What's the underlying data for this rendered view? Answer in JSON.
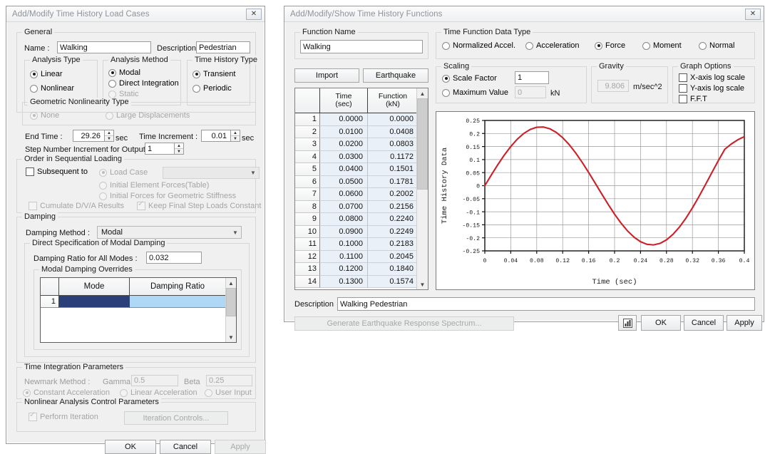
{
  "left_dialog": {
    "title": "Add/Modify Time History Load Cases",
    "close_icon": "close-icon",
    "general": {
      "legend": "General",
      "name_label": "Name :",
      "name_value": "Walking",
      "description_label": "Description :",
      "description_value": "Pedestrian",
      "analysis_type": {
        "legend": "Analysis Type",
        "options": [
          "Linear",
          "Nonlinear"
        ],
        "selected": "Linear"
      },
      "analysis_method": {
        "legend": "Analysis Method",
        "options": [
          "Modal",
          "Direct Integration",
          "Static"
        ],
        "selected": "Modal",
        "disabled": [
          "Static"
        ]
      },
      "time_history_type": {
        "legend": "Time History Type",
        "options": [
          "Transient",
          "Periodic"
        ],
        "selected": "Transient"
      },
      "geometric_nonlinearity": {
        "legend": "Geometric Nonlinearity Type",
        "options": [
          "None",
          "Large Displacements"
        ],
        "selected": "None",
        "disabled": true
      },
      "end_time_label": "End Time :",
      "end_time_value": "29.26",
      "end_time_unit": "sec",
      "time_increment_label": "Time Increment :",
      "time_increment_value": "0.01",
      "time_increment_unit": "sec",
      "step_number_label": "Step Number Increment for Output :",
      "step_number_value": "1"
    },
    "order_sequential": {
      "legend": "Order in Sequential Loading",
      "subsequent_to": "Subsequent to",
      "subsequent_checked": false,
      "radio_options": [
        "Load Case",
        "Initial Element Forces(Table)",
        "Initial Forces for Geometric Stiffness"
      ],
      "radio_selected": "Load Case",
      "combo_value": "",
      "cumulate_label": "Cumulate D/V/A Results",
      "cumulate_checked": false,
      "keep_final_label": "Keep Final Step Loads Constant",
      "keep_final_checked": true
    },
    "damping": {
      "legend": "Damping",
      "method_label": "Damping Method :",
      "method_value": "Modal",
      "direct_spec_legend": "Direct Specification of Modal Damping",
      "ratio_label": "Damping Ratio for All Modes :",
      "ratio_value": "0.032",
      "overrides_legend": "Modal Damping Overrides",
      "table_headers": [
        "",
        "Mode",
        "Damping Ratio"
      ],
      "table_rows": [
        {
          "index": "1",
          "mode": "",
          "ratio": ""
        }
      ]
    },
    "time_integration": {
      "legend": "Time Integration Parameters",
      "newmark_label": "Newmark Method :",
      "gamma_label": "Gamma",
      "gamma_value": "0.5",
      "beta_label": "Beta",
      "beta_value": "0.25",
      "options": [
        "Constant Acceleration",
        "Linear Acceleration",
        "User Input"
      ],
      "selected": "Constant Acceleration",
      "disabled": true
    },
    "nonlinear_control": {
      "legend": "Nonlinear Analysis Control Parameters",
      "perform_iteration_label": "Perform Iteration",
      "perform_iteration_checked": true,
      "iteration_controls_button": "Iteration Controls...",
      "disabled": true
    },
    "buttons": {
      "ok": "OK",
      "cancel": "Cancel",
      "apply": "Apply",
      "apply_disabled": true
    }
  },
  "right_dialog": {
    "title": "Add/Modify/Show Time History Functions",
    "close_icon": "close-icon",
    "function_name": {
      "legend": "Function Name",
      "value": "Walking"
    },
    "import_button": "Import",
    "earthquake_button": "Earthquake",
    "data_type": {
      "legend": "Time Function Data Type",
      "options": [
        "Normalized Accel.",
        "Acceleration",
        "Force",
        "Moment",
        "Normal"
      ],
      "selected": "Force"
    },
    "scaling": {
      "legend": "Scaling",
      "scale_factor_label": "Scale Factor",
      "scale_factor_value": "1",
      "maximum_value_label": "Maximum Value",
      "maximum_value_value": "0",
      "maximum_value_unit": "kN",
      "selected": "Scale Factor"
    },
    "gravity": {
      "legend": "Gravity",
      "value": "9.806",
      "unit": "m/sec^2",
      "disabled": true
    },
    "graph_options": {
      "legend": "Graph Options",
      "options": [
        "X-axis log scale",
        "Y-axis log scale",
        "F.F.T"
      ],
      "checked": []
    },
    "table": {
      "headers": [
        {
          "line1": "",
          "line2": ""
        },
        {
          "line1": "Time",
          "line2": "(sec)"
        },
        {
          "line1": "Function",
          "line2": "(kN)"
        }
      ],
      "rows": [
        {
          "index": "1",
          "time": "0.0000",
          "value": "0.0000"
        },
        {
          "index": "2",
          "time": "0.0100",
          "value": "0.0408"
        },
        {
          "index": "3",
          "time": "0.0200",
          "value": "0.0803"
        },
        {
          "index": "4",
          "time": "0.0300",
          "value": "0.1172"
        },
        {
          "index": "5",
          "time": "0.0400",
          "value": "0.1501"
        },
        {
          "index": "6",
          "time": "0.0500",
          "value": "0.1781"
        },
        {
          "index": "7",
          "time": "0.0600",
          "value": "0.2002"
        },
        {
          "index": "8",
          "time": "0.0700",
          "value": "0.2156"
        },
        {
          "index": "9",
          "time": "0.0800",
          "value": "0.2240"
        },
        {
          "index": "10",
          "time": "0.0900",
          "value": "0.2249"
        },
        {
          "index": "11",
          "time": "0.1000",
          "value": "0.2183"
        },
        {
          "index": "12",
          "time": "0.1100",
          "value": "0.2045"
        },
        {
          "index": "13",
          "time": "0.1200",
          "value": "0.1840"
        },
        {
          "index": "14",
          "time": "0.1300",
          "value": "0.1574"
        }
      ]
    },
    "description_label": "Description",
    "description_value": "Walking Pedestrian",
    "generate_spectrum_button": "Generate Earthquake Response Spectrum...",
    "plot_icon": "bar-chart-icon",
    "buttons": {
      "ok": "OK",
      "cancel": "Cancel",
      "apply": "Apply"
    }
  },
  "chart_data": {
    "type": "line",
    "title": "",
    "xlabel": "Time (sec)",
    "ylabel": "Time History Data",
    "xlim": [
      0,
      0.4
    ],
    "ylim": [
      -0.25,
      0.25
    ],
    "xticks": [
      0,
      0.04,
      0.08,
      0.12,
      0.16,
      0.2,
      0.24,
      0.28,
      0.32,
      0.36,
      0.4
    ],
    "xtick_labels": [
      "0",
      "0.04",
      "0.08",
      "0.12",
      "0.16",
      "0.2",
      "0.24",
      "0.28",
      "0.32",
      "0.36",
      "0.4"
    ],
    "yticks": [
      0.25,
      0.2,
      0.15,
      0.1,
      0.05,
      0,
      -0.05,
      -0.1,
      -0.15,
      -0.2,
      -0.25
    ],
    "ytick_labels": [
      "0.25",
      "0.2",
      "0.15",
      "0.1",
      "0.05",
      "0",
      "-0.05",
      "-0.1",
      "-0.15",
      "-0.2",
      "-0.25"
    ],
    "grid": true,
    "legend": false,
    "line_color": "#cc2029",
    "series": [
      {
        "name": "Walking",
        "x": [
          0,
          0.01,
          0.02,
          0.03,
          0.04,
          0.05,
          0.06,
          0.07,
          0.08,
          0.09,
          0.1,
          0.11,
          0.12,
          0.13,
          0.14,
          0.15,
          0.16,
          0.17,
          0.18,
          0.19,
          0.2,
          0.21,
          0.22,
          0.23,
          0.24,
          0.25,
          0.26,
          0.27,
          0.28,
          0.29,
          0.3,
          0.31,
          0.32,
          0.33,
          0.34,
          0.35,
          0.36,
          0.37,
          0.38,
          0.39,
          0.4
        ],
        "y": [
          0.0,
          0.0408,
          0.0803,
          0.1172,
          0.1501,
          0.1781,
          0.2002,
          0.2156,
          0.224,
          0.2249,
          0.2183,
          0.2045,
          0.184,
          0.1574,
          0.1256,
          0.0897,
          0.0508,
          0.0101,
          -0.031,
          -0.0713,
          -0.1093,
          -0.1437,
          -0.1735,
          -0.1975,
          -0.2149,
          -0.2249,
          -0.2271,
          -0.2214,
          -0.2078,
          -0.1867,
          -0.1587,
          -0.1245,
          -0.0852,
          -0.042,
          0.0037,
          0.0503,
          0.0963,
          0.14,
          0.16,
          0.176,
          0.188
        ]
      }
    ]
  }
}
